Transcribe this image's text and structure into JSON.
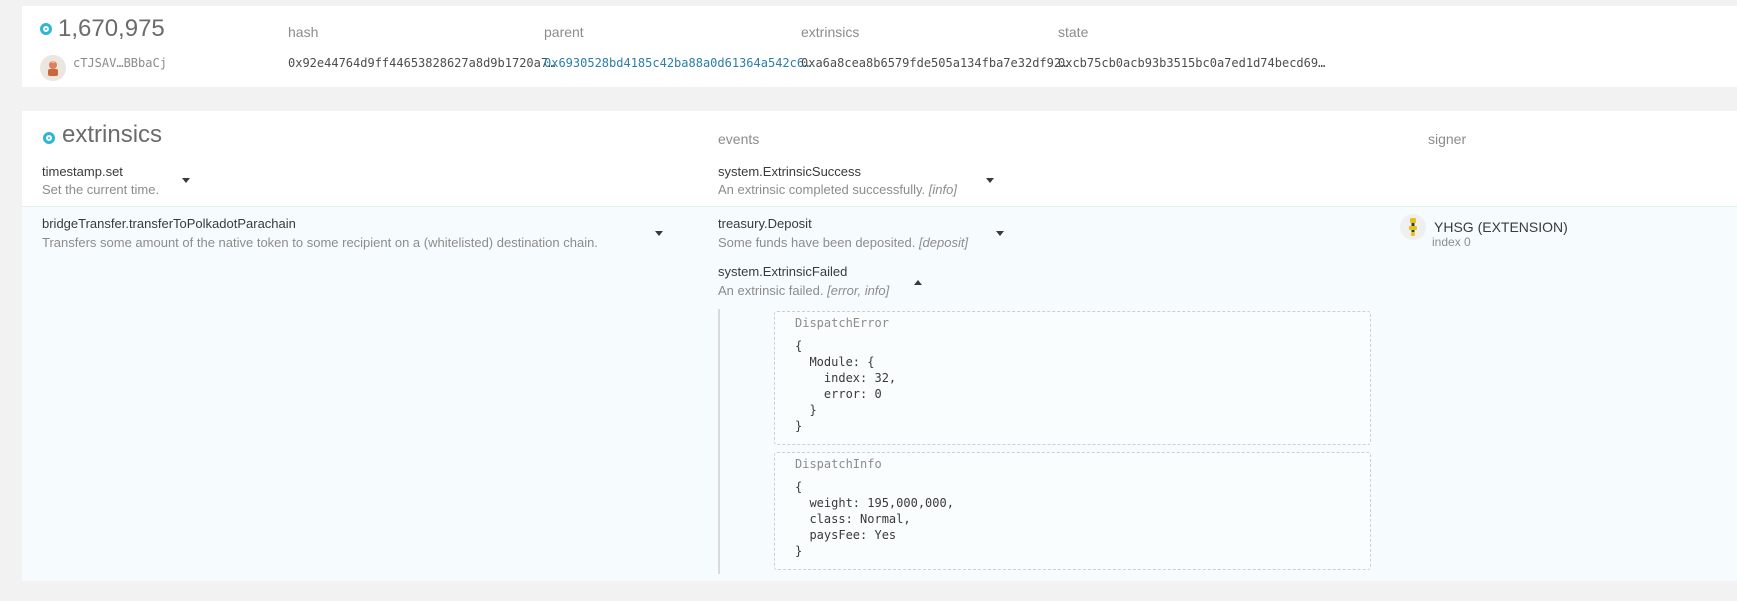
{
  "block": {
    "number": "1,670,975",
    "author": "cTJSAV…BBbaCj",
    "labels": {
      "hash": "hash",
      "parent": "parent",
      "extrinsics": "extrinsics",
      "state": "state"
    },
    "hash": "0x92e44764d9ff44653828627a8d9b1720a7…",
    "parent": "0x6930528bd4185c42ba88a0d61364a542c6…",
    "extrinsics_root": "0xa6a8cea8b6579fde505a134fba7e32df92…",
    "state_root": "0xcb75cb0acb93b3515bc0a7ed1d74becd69…"
  },
  "extrinsics": {
    "title": "extrinsics",
    "events_label": "events",
    "signer_label": "signer",
    "rows": [
      {
        "call": "timestamp.set",
        "description": "Set the current time.",
        "events": [
          {
            "name": "system.ExtrinsicSuccess",
            "description": "An extrinsic completed successfully.",
            "tag": "[info]"
          }
        ]
      },
      {
        "call": "bridgeTransfer.transferToPolkadotParachain",
        "description": "Transfers some amount of the native token to some recipient on a (whitelisted) destination chain.",
        "events": [
          {
            "name": "treasury.Deposit",
            "description": "Some funds have been deposited.",
            "tag": "[deposit]"
          },
          {
            "name": "system.ExtrinsicFailed",
            "description": "An extrinsic failed.",
            "tag": "[error, info]"
          }
        ],
        "params": [
          {
            "label": "DispatchError",
            "json": "{\n  Module: {\n    index: 32,\n    error: 0\n  }\n}"
          },
          {
            "label": "DispatchInfo",
            "json": "{\n  weight: 195,000,000,\n  class: Normal,\n  paysFee: Yes\n}"
          }
        ],
        "signer": {
          "name": "YHSG (EXTENSION)",
          "index": "index 0"
        }
      }
    ]
  },
  "colors": {
    "accent": "#2eb6d8",
    "link": "#2b7ea8",
    "highlight_row": "#f6fcfd"
  }
}
